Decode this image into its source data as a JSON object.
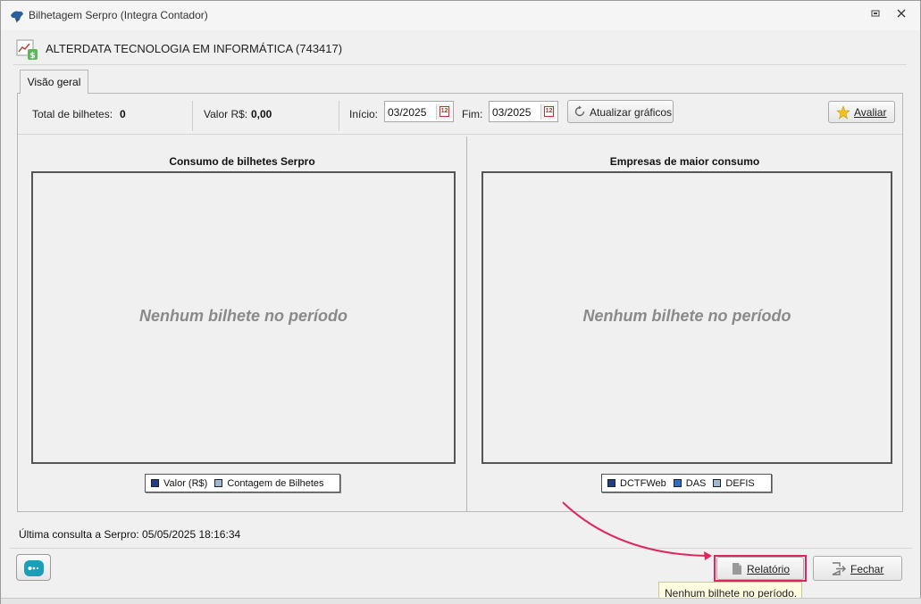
{
  "window": {
    "title": "Bilhetagem Serpro (Integra Contador)",
    "restore_icon": "restore-icon",
    "close_icon": "close-icon"
  },
  "company": {
    "name": "ALTERDATA TECNOLOGIA EM INFORMÁTICA (743417)",
    "icon": "money-chart-icon"
  },
  "tabs": [
    {
      "label": "Visão geral",
      "active": true
    }
  ],
  "stats": {
    "total_label": "Total de bilhetes:",
    "total_value": "0",
    "valor_label": "Valor R$:",
    "valor_value": "0,00"
  },
  "period": {
    "inicio_label": "Início:",
    "inicio_value": "03/2025",
    "fim_label": "Fim:",
    "fim_value": "03/2025",
    "calendar_icon_text": "12"
  },
  "toolbar": {
    "refresh_label": "Atualizar gráficos",
    "evaluate_label": "Avaliar"
  },
  "charts": {
    "left": {
      "title": "Consumo de bilhetes Serpro",
      "empty_message": "Nenhum bilhete no período",
      "legend": [
        {
          "label": "Valor (R$)",
          "color": "#1f3f8a"
        },
        {
          "label": "Contagem de Bilhetes",
          "color": "#9fb8d8"
        }
      ]
    },
    "right": {
      "title": "Empresas de maior consumo",
      "empty_message": "Nenhum bilhete no período",
      "legend": [
        {
          "label": "DCTFWeb",
          "color": "#1f3f8a"
        },
        {
          "label": "DAS",
          "color": "#2c6fc4"
        },
        {
          "label": "DEFIS",
          "color": "#9fb8d8"
        }
      ]
    }
  },
  "footer": {
    "last_query": "Última consulta a Serpro: 05/05/2025 18:16:34",
    "report_label": "Relatório",
    "close_label": "Fechar",
    "tooltip": "Nenhum bilhete no período."
  },
  "colors": {
    "highlight": "#e0245e",
    "accent": "#1a9fb8"
  },
  "chart_data": [
    {
      "type": "bar",
      "title": "Consumo de bilhetes Serpro",
      "categories": [],
      "series": [
        {
          "name": "Valor (R$)",
          "values": []
        },
        {
          "name": "Contagem de Bilhetes",
          "values": []
        }
      ],
      "annotation": "Nenhum bilhete no período"
    },
    {
      "type": "bar",
      "title": "Empresas de maior consumo",
      "categories": [],
      "series": [
        {
          "name": "DCTFWeb",
          "values": []
        },
        {
          "name": "DAS",
          "values": []
        },
        {
          "name": "DEFIS",
          "values": []
        }
      ],
      "annotation": "Nenhum bilhete no período"
    }
  ]
}
